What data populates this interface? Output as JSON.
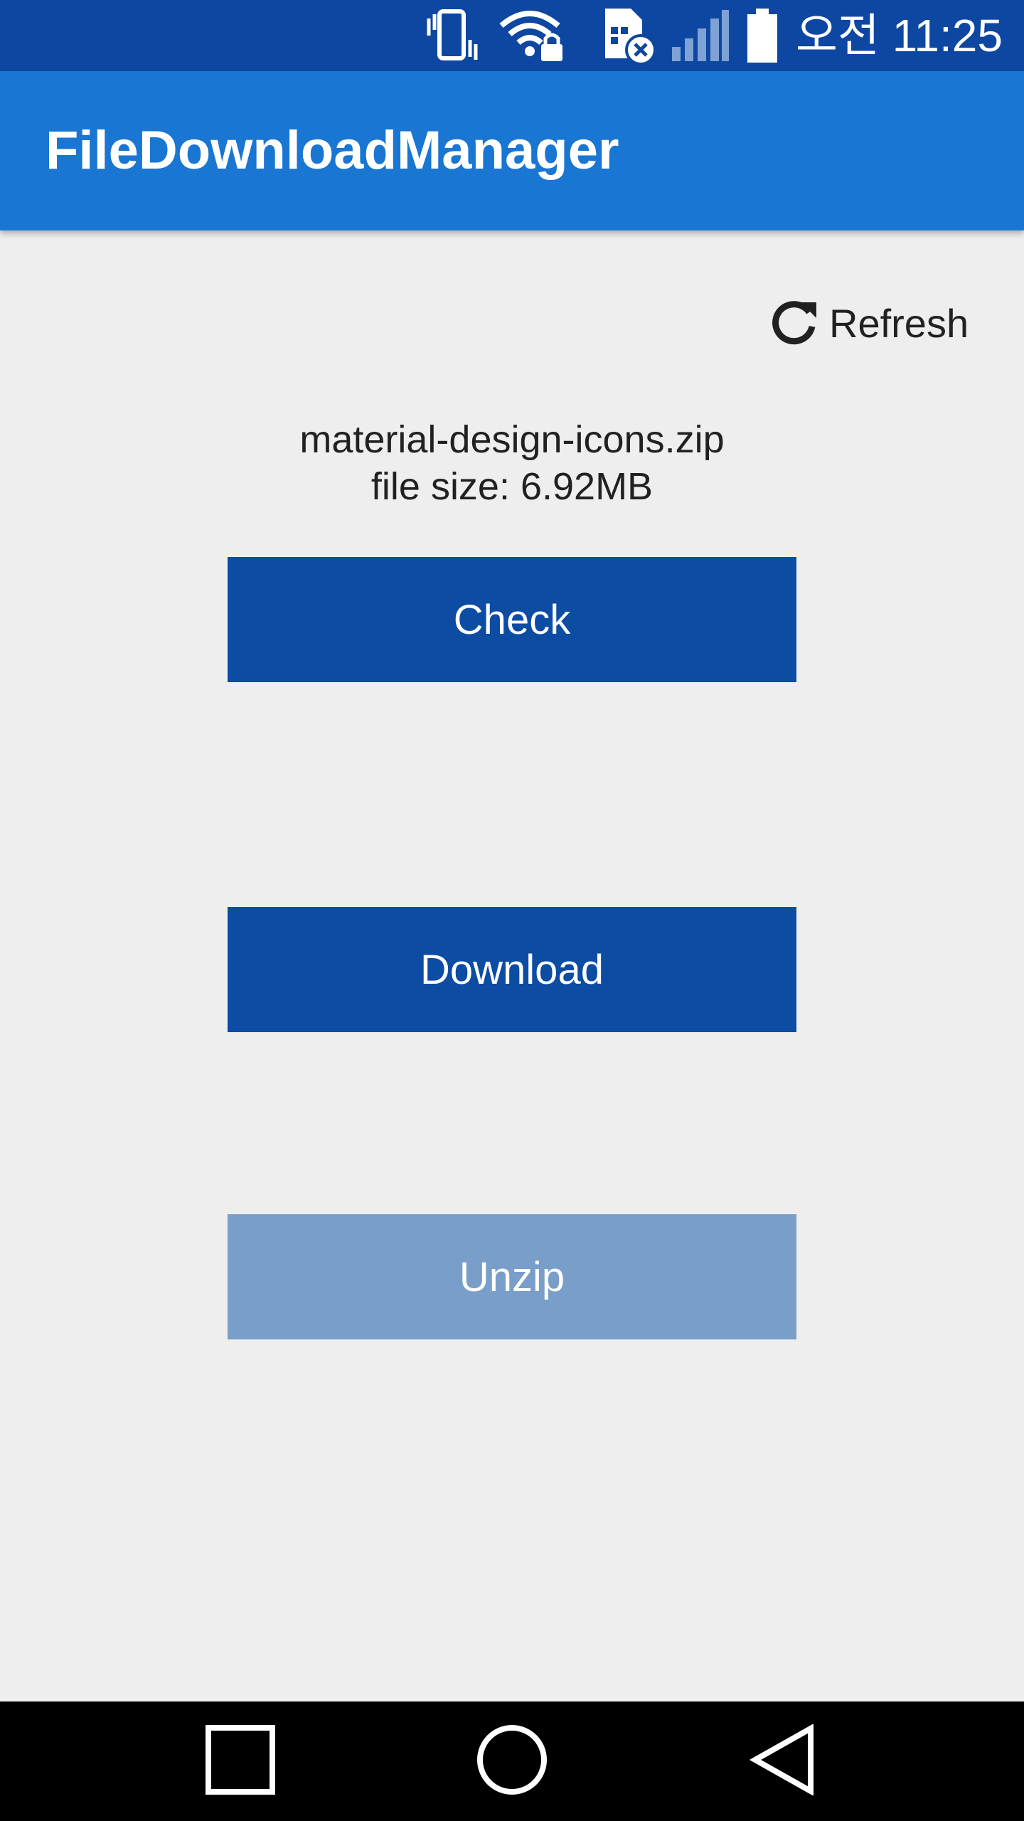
{
  "status_bar": {
    "time": "오전 11:25",
    "icons": [
      "vibrate-icon",
      "wifi-lock-icon",
      "sim-error-icon",
      "signal-icon",
      "battery-icon"
    ],
    "background": "#0d47a1"
  },
  "app_bar": {
    "title": "FileDownloadManager",
    "background": "#1976d2"
  },
  "refresh": {
    "icon": "refresh-icon",
    "label": "Refresh"
  },
  "file": {
    "name": "material-design-icons.zip",
    "size_text": "file size: 6.92MB"
  },
  "buttons": {
    "check_label": "Check",
    "download_label": "Download",
    "unzip_label": "Unzip",
    "enabled_color": "#0d4ca3",
    "disabled_color": "#789ec9"
  },
  "nav_bar": {
    "icons": [
      "recents-icon",
      "home-icon",
      "back-icon"
    ]
  }
}
